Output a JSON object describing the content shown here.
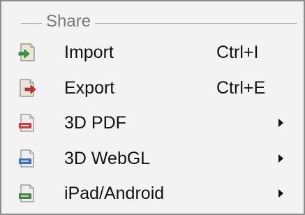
{
  "menu": {
    "section_title": "Share",
    "items": [
      {
        "label": "Import",
        "shortcut": "Ctrl+I",
        "icon": "import-icon",
        "has_submenu": false,
        "accent": "#2e9e3e"
      },
      {
        "label": "Export",
        "shortcut": "Ctrl+E",
        "icon": "export-icon",
        "has_submenu": false,
        "accent": "#c8322e"
      },
      {
        "label": "3D PDF",
        "shortcut": "",
        "icon": "pdf-file-icon",
        "has_submenu": true,
        "accent": "#d63a3a"
      },
      {
        "label": "3D WebGL",
        "shortcut": "",
        "icon": "webgl-file-icon",
        "has_submenu": true,
        "accent": "#3a6fd6"
      },
      {
        "label": "iPad/Android",
        "shortcut": "",
        "icon": "mobile-file-icon",
        "has_submenu": true,
        "accent": "#3a8a3a"
      }
    ]
  }
}
